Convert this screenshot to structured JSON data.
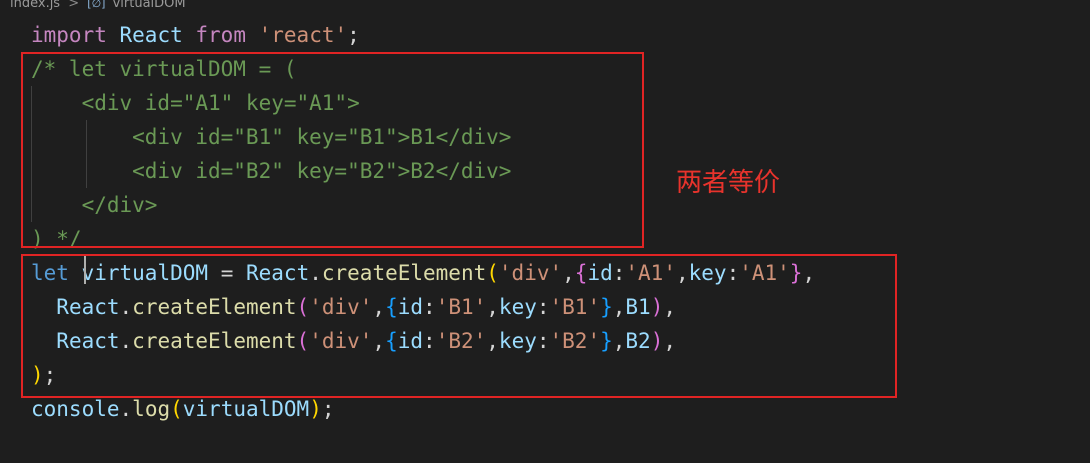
{
  "breadcrumb": {
    "file": "index.js",
    "separator": ">",
    "symbol_icon": "[∅]",
    "symbol": "virtualDOM"
  },
  "code_lines": [
    "import React from 'react';",
    "/* let virtualDOM = (",
    "    <div id=\"A1\" key=\"A1\">",
    "        <div id=\"B1\" key=\"B1\">B1</div>",
    "        <div id=\"B2\" key=\"B2\">B2</div>",
    "    </div>",
    ") */",
    "let virtualDOM = React.createElement('div',{id:'A1',key:'A1'},",
    "  React.createElement('div',{id:'B1',key:'B1'},B1),",
    "  React.createElement('div',{id:'B2',key:'B2'},B2),",
    ");",
    "console.log(virtualDOM);"
  ],
  "tokens": {
    "l0": [
      "import",
      "React",
      "from",
      "'react'",
      ";"
    ],
    "l7": [
      "let",
      "virtualDOM",
      "=",
      "React",
      ".",
      "createElement",
      "(",
      "'div'",
      ",",
      "{",
      "id",
      ":",
      "'A1'",
      ",",
      "key",
      ":",
      "'A1'",
      "}",
      ","
    ],
    "l8": [
      "React",
      ".",
      "createElement",
      "(",
      "'div'",
      ",",
      "{",
      "id",
      ":",
      "'B1'",
      ",",
      "key",
      ":",
      "'B1'",
      "}",
      ",",
      "B1",
      ")",
      ","
    ],
    "l9": [
      "React",
      ".",
      "createElement",
      "(",
      "'div'",
      ",",
      "{",
      "id",
      ":",
      "'B2'",
      ",",
      "key",
      ":",
      "'B2'",
      "}",
      ",",
      "B2",
      ")",
      ","
    ],
    "l10": [
      ")",
      ";"
    ],
    "l11": [
      "console",
      ".",
      "log",
      "(",
      "virtualDOM",
      ")",
      ";"
    ]
  },
  "annotation": {
    "text": "两者等价",
    "color": "#e8332c"
  },
  "colors": {
    "background": "#1e1e1e",
    "highlight_box": "#e02424",
    "keyword": "#569cd6",
    "string": "#ce9178",
    "comment": "#6a9955",
    "function": "#dcdcaa",
    "variable": "#9cdcfe"
  }
}
